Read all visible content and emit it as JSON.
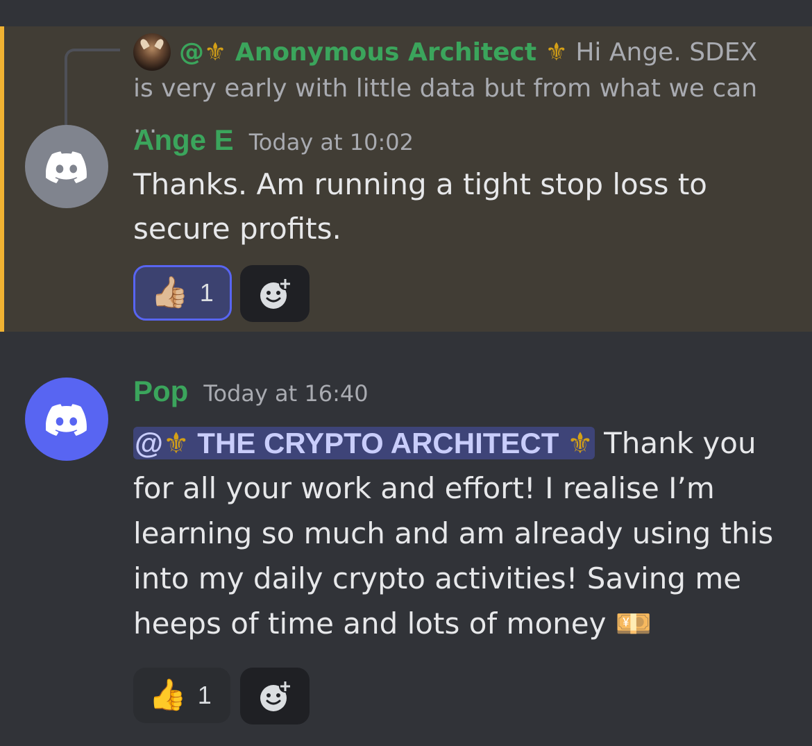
{
  "reply_preview": {
    "mention_prefix": "@",
    "fleur_left": "⚜",
    "author": "Anonymous Architect",
    "fleur_right": "⚜",
    "snippet_line1": "Hi Ange. SDEX",
    "snippet_line2": "is very early with little data but from what we can ..."
  },
  "messages": [
    {
      "author": "Ange E",
      "timestamp": "Today at 10:02",
      "text": "Thanks. Am running a tight stop loss to secure profits.",
      "avatar_color": "#80848e",
      "reaction": {
        "emoji": "👍🏼",
        "count": "1"
      }
    },
    {
      "author": "Pop",
      "timestamp": "Today at 16:40",
      "mention": {
        "prefix": "@",
        "fleur_left": "⚜",
        "name": "THE CRYPTO ARCHITECT",
        "fleur_right": "⚜"
      },
      "text": "Thank you for all your work and effort! I realise I’m learning so much and am already using this into my daily crypto activities! Saving me heeps of time and lots of money",
      "trailing_emoji": "💴",
      "avatar_color": "#5865f2",
      "reaction": {
        "emoji": "👍",
        "count": "1"
      }
    }
  ],
  "icons": {
    "avatar_icon": "discord-logo-icon",
    "add_reaction_icon": "add-reaction-icon",
    "reply_avatar": "bull-avatar-icon"
  },
  "colors": {
    "background": "#313338",
    "highlight_background": "#413d35",
    "highlight_accent": "#f0b232",
    "author_green": "#3ba55c",
    "mention_blue": "#5865f2"
  }
}
